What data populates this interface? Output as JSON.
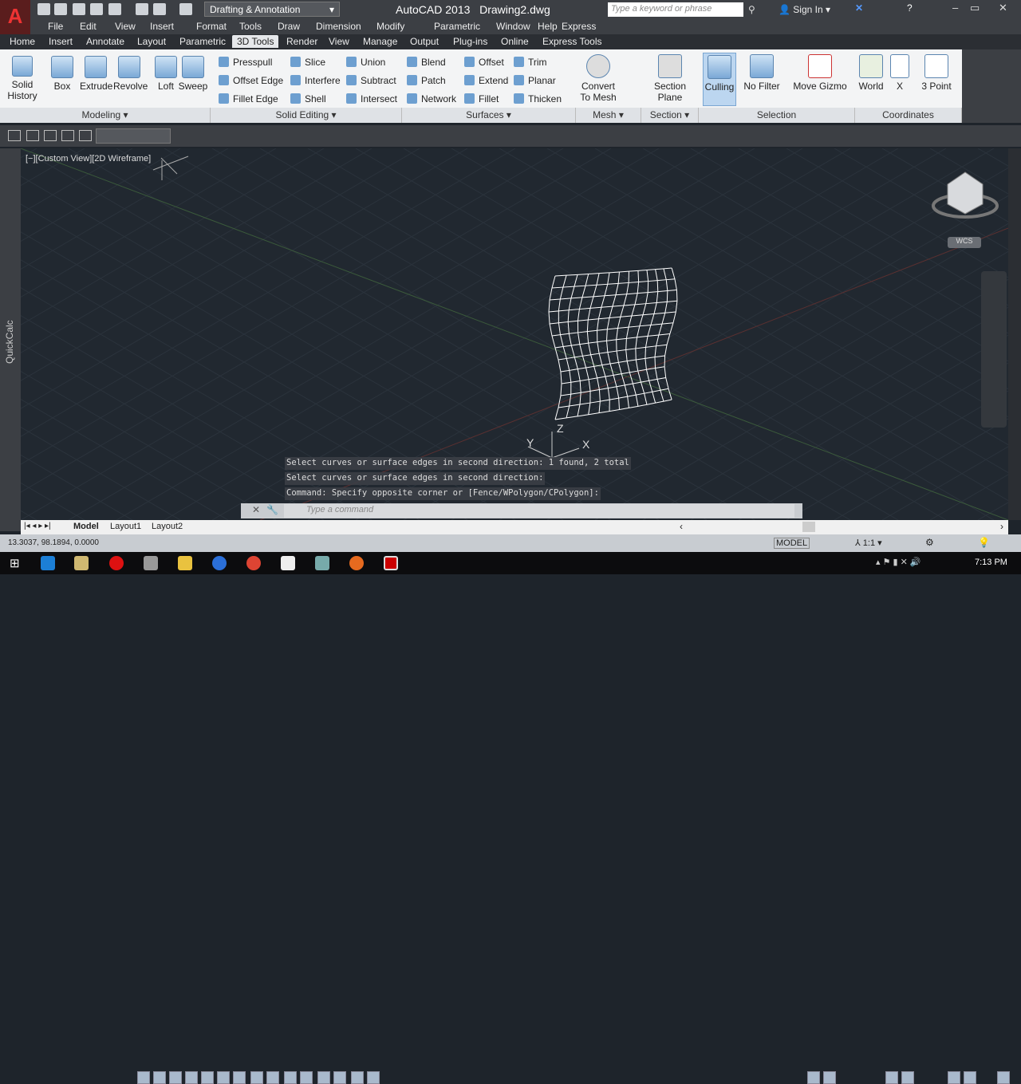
{
  "title": {
    "app": "AutoCAD 2013",
    "file": "Drawing2.dwg",
    "workspace": "Drafting & Annotation",
    "search_placeholder": "Type a keyword or phrase",
    "signin": "Sign In"
  },
  "menus": [
    "File",
    "Edit",
    "View",
    "Insert",
    "Format",
    "Tools",
    "Draw",
    "Dimension",
    "Modify",
    "Parametric",
    "Window",
    "Help",
    "Express"
  ],
  "tabs": [
    "Home",
    "Insert",
    "Annotate",
    "Layout",
    "Parametric",
    "3D Tools",
    "Render",
    "View",
    "Manage",
    "Output",
    "Plug-ins",
    "Online",
    "Express Tools"
  ],
  "active_tab": "3D Tools",
  "ribbon": {
    "solid_history": [
      "Solid",
      "History"
    ],
    "modeling": {
      "title": "Modeling",
      "items": [
        "Box",
        "Extrude",
        "Revolve",
        "Loft",
        "Sweep"
      ]
    },
    "solid_editing": {
      "title": "Solid Editing",
      "items": [
        "Presspull",
        "Slice",
        "Union",
        "Offset Edge",
        "Interfere",
        "Subtract",
        "Fillet Edge",
        "Shell",
        "Intersect"
      ]
    },
    "surfaces": {
      "title": "Surfaces",
      "items": [
        "Blend",
        "Offset",
        "Trim",
        "Patch",
        "Extend",
        "Planar",
        "Network",
        "Fillet",
        "Thicken"
      ]
    },
    "mesh": {
      "title": "Mesh",
      "convert": [
        "Convert",
        "To Mesh"
      ]
    },
    "section": {
      "title": "Section",
      "plane": [
        "Section",
        "Plane"
      ]
    },
    "selection": {
      "title": "Selection",
      "items": [
        "Culling",
        "No Filter",
        "Move Gizmo"
      ]
    },
    "coordinates": {
      "title": "Coordinates",
      "items": [
        "World",
        "X",
        "3 Point"
      ]
    }
  },
  "viewport": {
    "label": "[−][Custom View][2D Wireframe]",
    "quickcalc": "QuickCalc",
    "wcs": "WCS",
    "axes": {
      "x": "X",
      "y": "Y",
      "z": "Z"
    }
  },
  "command": {
    "history": [
      "Select curves or surface edges in second direction: 1 found, 2 total",
      "Select curves or surface edges in second direction:",
      "Command: Specify opposite corner or [Fence/WPolygon/CPolygon]:"
    ],
    "placeholder": "Type a command"
  },
  "layout_tabs": [
    "Model",
    "Layout1",
    "Layout2"
  ],
  "status": {
    "coords": "13.3037, 98.1894, 0.0000",
    "model": "MODEL",
    "scale": "1:1"
  },
  "clock": "7:13 PM"
}
